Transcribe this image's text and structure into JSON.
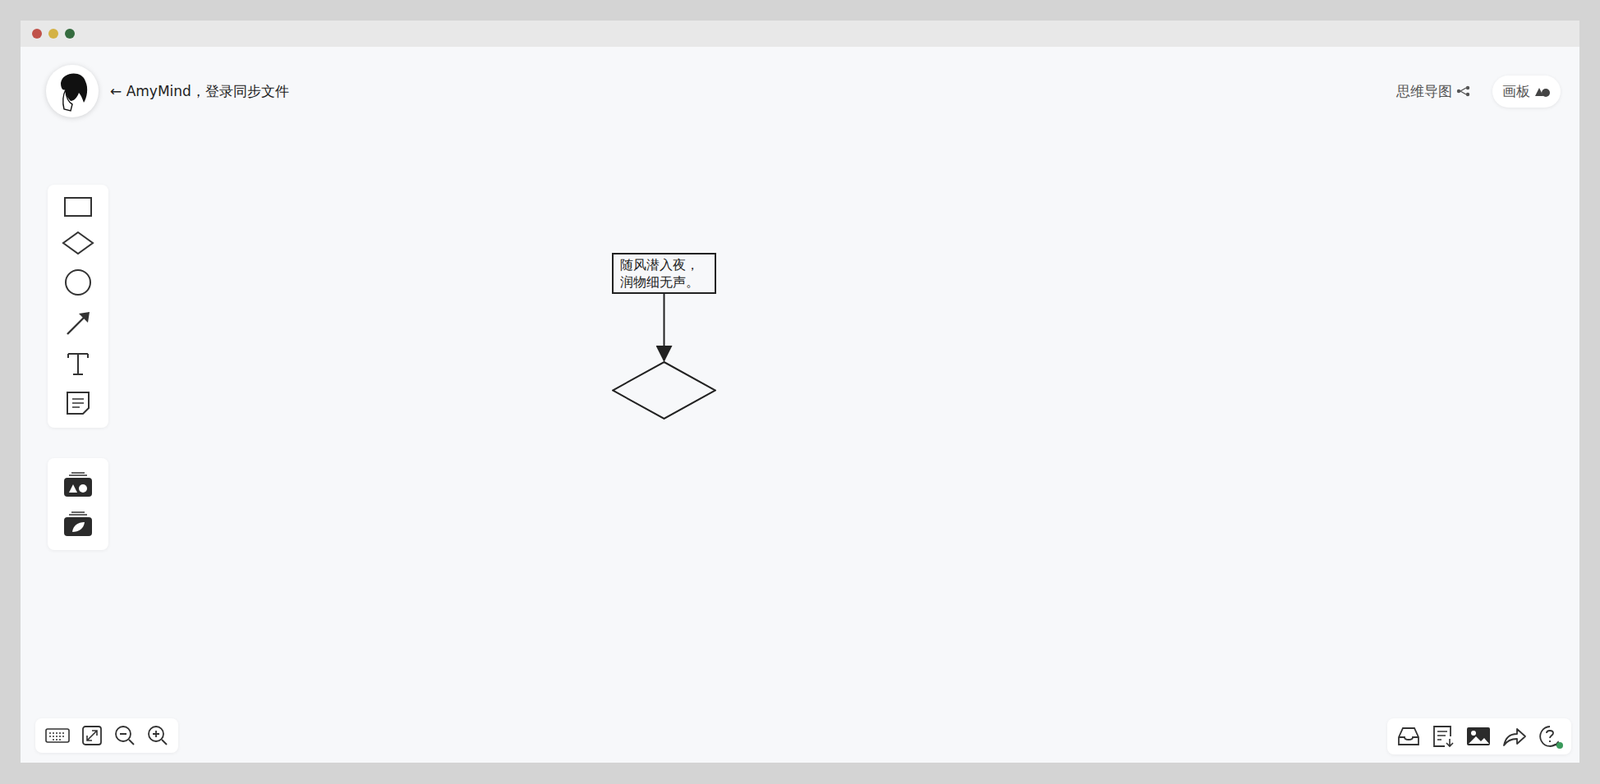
{
  "header": {
    "back_link": "← AmyMind，登录同步文件"
  },
  "modes": [
    {
      "label": "思维导图",
      "selected": false
    },
    {
      "label": "画板",
      "selected": true
    }
  ],
  "canvas": {
    "nodes": [
      {
        "kind": "rectangle",
        "lines": [
          "随风潜入夜，",
          "润物细无声。"
        ]
      },
      {
        "kind": "diamond",
        "lines": []
      }
    ],
    "connectors": [
      {
        "from": 0,
        "to": 1
      }
    ]
  },
  "help": {
    "notification": true
  }
}
